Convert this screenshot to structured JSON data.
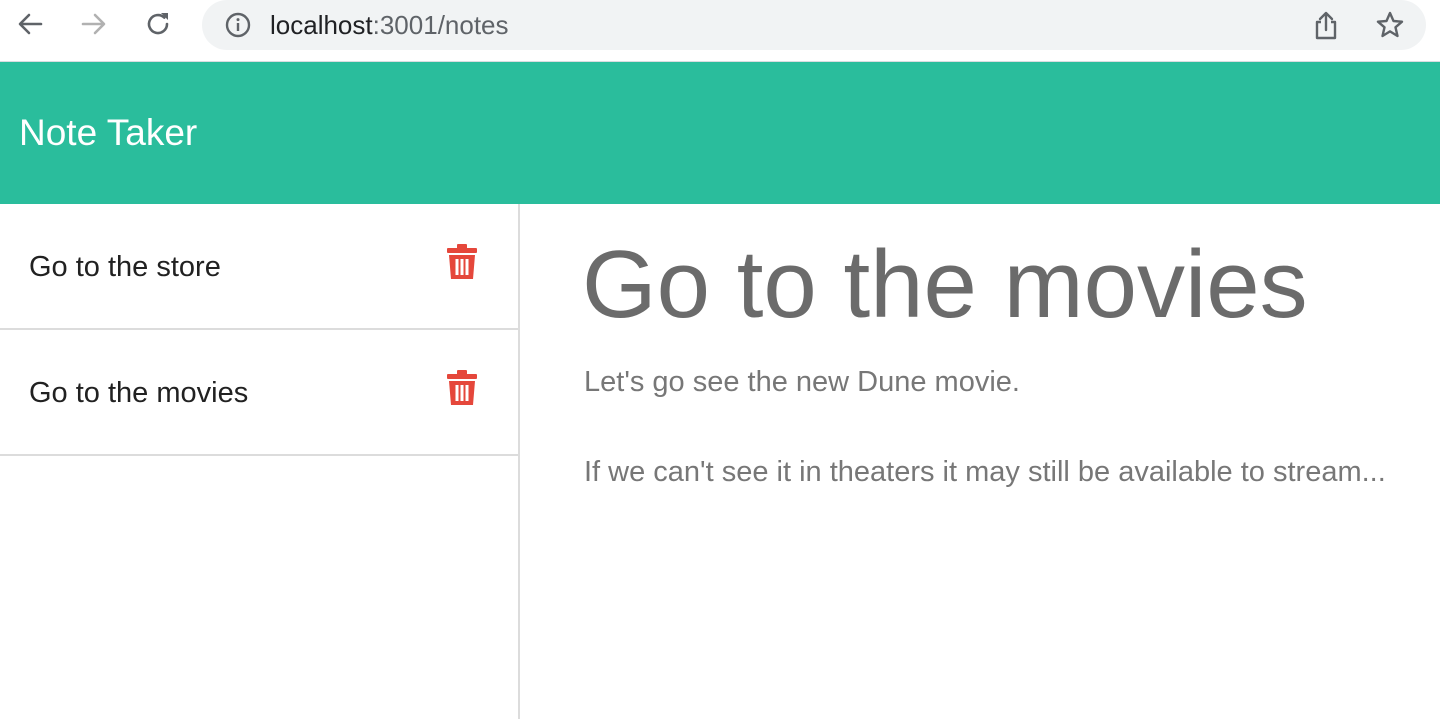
{
  "browser": {
    "url_host": "localhost",
    "url_path": ":3001/notes",
    "icons": {
      "back": "arrow-left-icon",
      "forward": "arrow-right-icon",
      "reload": "reload-icon",
      "info": "info-icon",
      "share": "share-icon",
      "bookmark": "star-icon"
    }
  },
  "header": {
    "title": "Note Taker",
    "bg_color": "#2abd9c"
  },
  "notes": [
    {
      "title": "Go to the store"
    },
    {
      "title": "Go to the movies"
    }
  ],
  "active_note": {
    "title": "Go to the movies",
    "paragraphs": [
      "Let's go see the new Dune movie.",
      "If we can't see it in theaters it may still be available to stream..."
    ]
  },
  "colors": {
    "delete_icon": "#e5473b",
    "divider": "#dcdcdc"
  }
}
